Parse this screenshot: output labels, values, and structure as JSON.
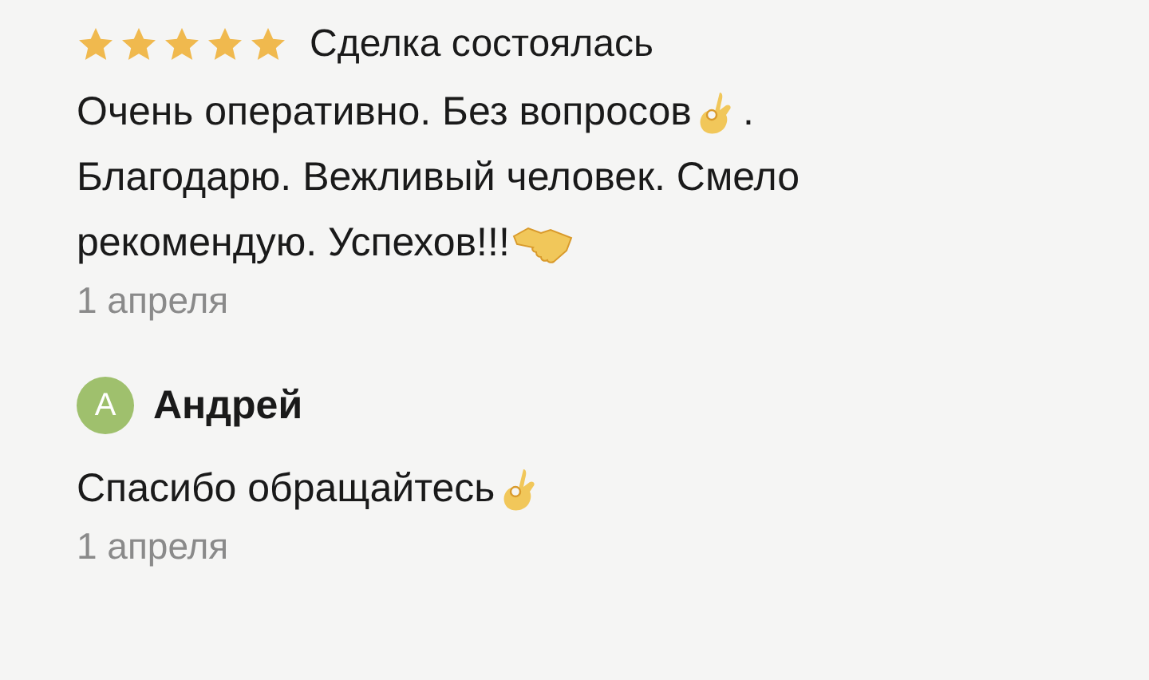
{
  "review": {
    "stars": 5,
    "status": "Сделка состоялась",
    "lines": [
      {
        "parts": [
          {
            "kind": "text",
            "text": "Очень оперативно. Без вопросов"
          },
          {
            "kind": "ok"
          },
          {
            "kind": "text",
            "text": "."
          }
        ]
      },
      {
        "parts": [
          {
            "kind": "text",
            "text": "Благодарю. Вежливый человек. Смело"
          }
        ]
      },
      {
        "parts": [
          {
            "kind": "text",
            "text": "рекомендую. Успехов!!!"
          },
          {
            "kind": "handshake"
          }
        ]
      }
    ],
    "date": "1 апреля"
  },
  "reply": {
    "avatar_letter": "А",
    "author": "Андрей",
    "lines": [
      {
        "parts": [
          {
            "kind": "text",
            "text": "Спасибо обращайтесь"
          },
          {
            "kind": "ok"
          }
        ]
      }
    ],
    "date": "1 апреля"
  }
}
